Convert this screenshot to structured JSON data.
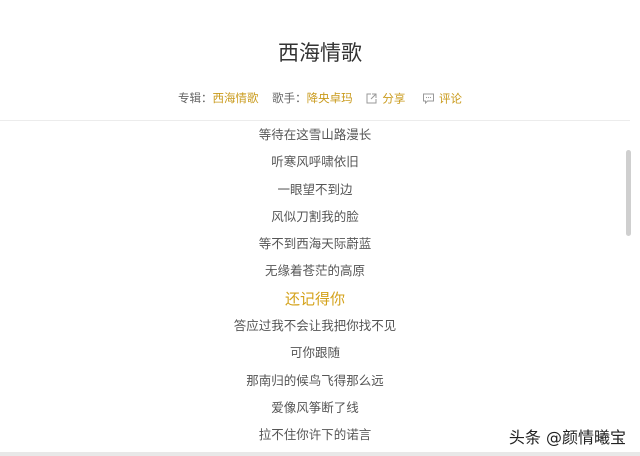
{
  "song": {
    "title": "西海情歌"
  },
  "meta": {
    "album_label": "专辑：",
    "album": "西海情歌",
    "singer_label": "歌手：",
    "singer": "降央卓玛",
    "share": "分享",
    "comment": "评论"
  },
  "lyrics": [
    "等待在这雪山路漫长",
    "听寒风呼啸依旧",
    "一眼望不到边",
    "风似刀割我的脸",
    "等不到西海天际蔚蓝",
    "无缘着苍茫的高原",
    "还记得你",
    "答应过我不会让我把你找不见",
    "可你跟随",
    "那南归的候鸟飞得那么远",
    "爱像风筝断了线",
    "拉不住你许下的诺言"
  ],
  "active_index": 6,
  "watermark": "头条 @颜情曦宝",
  "colors": {
    "accent": "#c99a1b"
  }
}
